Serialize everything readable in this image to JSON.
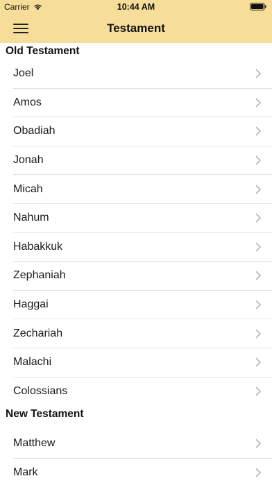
{
  "status_bar": {
    "carrier": "Carrier",
    "time": "10:44 AM"
  },
  "nav": {
    "title": "Testament",
    "menu_icon": "hamburger-menu-icon"
  },
  "colors": {
    "header_bg": "#f7dd9a",
    "divider": "#e2e2e2",
    "chevron": "#b5b5b5"
  },
  "sections": [
    {
      "title": "Old Testament",
      "items": [
        "Joel",
        "Amos",
        "Obadiah",
        "Jonah",
        "Micah",
        "Nahum",
        "Habakkuk",
        "Zephaniah",
        "Haggai",
        "Zechariah",
        "Malachi",
        "Colossians"
      ]
    },
    {
      "title": "New Testament",
      "items": [
        "Matthew",
        "Mark"
      ]
    }
  ]
}
